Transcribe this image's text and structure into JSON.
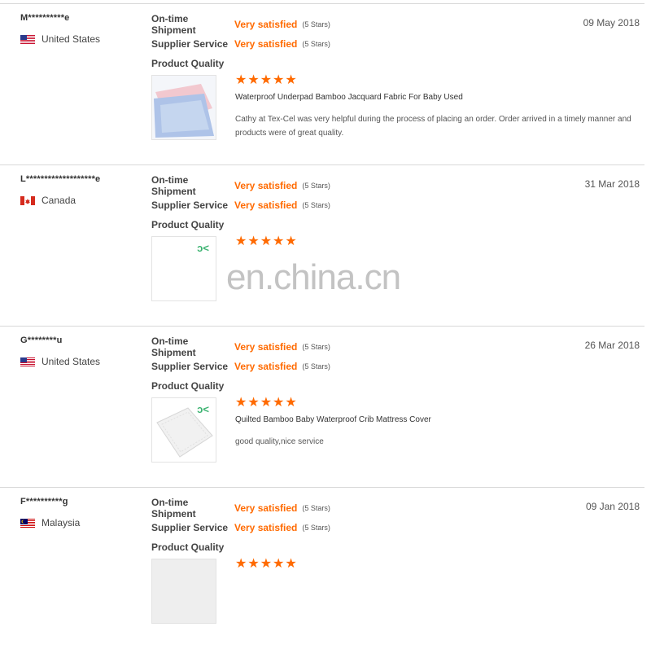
{
  "reviews": [
    {
      "buyer": "M**********e",
      "country": "United States",
      "flag": "us",
      "date": "09 May 2018",
      "ratings": [
        {
          "label": "On-time Shipment",
          "value": "Very satisfied",
          "stars_text": "(5 Stars)"
        },
        {
          "label": "Supplier Service",
          "value": "Very satisfied",
          "stars_text": "(5 Stars)"
        },
        {
          "label": "Product Quality",
          "value": "",
          "stars_text": ""
        }
      ],
      "product_stars": 5,
      "product_title": "Waterproof Underpad Bamboo Jacquard Fabric For Baby Used",
      "text": "Cathy at Tex-Cel was very helpful during the process of placing an order. Order arrived in a timely manner and products were of great quality."
    },
    {
      "buyer": "L*******************e",
      "country": "Canada",
      "flag": "ca",
      "date": "31 Mar 2018",
      "ratings": [
        {
          "label": "On-time Shipment",
          "value": "Very satisfied",
          "stars_text": "(5 Stars)"
        },
        {
          "label": "Supplier Service",
          "value": "Very satisfied",
          "stars_text": "(5 Stars)"
        },
        {
          "label": "Product Quality",
          "value": "",
          "stars_text": ""
        }
      ],
      "product_stars": 5,
      "product_title": "",
      "text": ""
    },
    {
      "buyer": "G********u",
      "country": "United States",
      "flag": "us",
      "date": "26 Mar 2018",
      "ratings": [
        {
          "label": "On-time Shipment",
          "value": "Very satisfied",
          "stars_text": "(5 Stars)"
        },
        {
          "label": "Supplier Service",
          "value": "Very satisfied",
          "stars_text": "(5 Stars)"
        },
        {
          "label": "Product Quality",
          "value": "",
          "stars_text": ""
        }
      ],
      "product_stars": 5,
      "product_title": "Quilted Bamboo Baby Waterproof Crib Mattress Cover",
      "text": "good quality,nice service"
    },
    {
      "buyer": "F**********g",
      "country": "Malaysia",
      "flag": "my",
      "date": "09 Jan 2018",
      "ratings": [
        {
          "label": "On-time Shipment",
          "value": "Very satisfied",
          "stars_text": "(5 Stars)"
        },
        {
          "label": "Supplier Service",
          "value": "Very satisfied",
          "stars_text": "(5 Stars)"
        },
        {
          "label": "Product Quality",
          "value": "",
          "stars_text": ""
        }
      ],
      "product_stars": 5,
      "product_title": "",
      "text": ""
    }
  ],
  "watermark": "en.china.cn",
  "colors": {
    "accent": "#ff6a00",
    "logo": "#3cb371"
  }
}
